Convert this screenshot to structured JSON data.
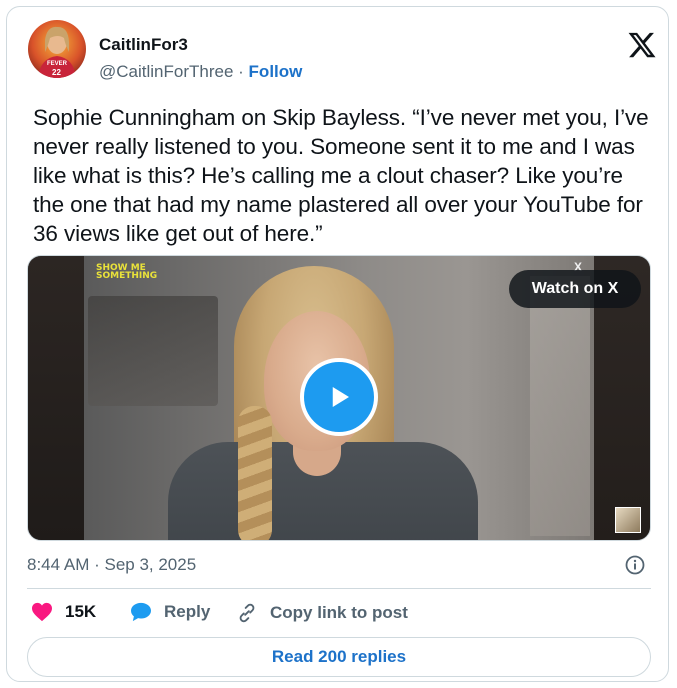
{
  "user": {
    "name": "CaitlinFor3",
    "handle": "@CaitlinForThree",
    "separator": "·",
    "follow_label": "Follow",
    "avatar_jersey_team": "FEVER",
    "avatar_jersey_number": "22"
  },
  "post": {
    "text": "Sophie Cunningham on Skip Bayless. “I’ve never met you, I’ve never really listened to you. Someone sent it to me and I was like what is this? He’s calling me a clout chaser? Like you’re the one that had my name plastered all over your YouTube for 36 views like get out of here.”",
    "timestamp": "8:44 AM · Sep 3, 2025"
  },
  "media": {
    "watch_label": "Watch on X",
    "watermark_line1": "SHOW ME",
    "watermark_line2": "SOMETHING",
    "corner_mark": "X"
  },
  "actions": {
    "likes_count": "15K",
    "reply_label": "Reply",
    "copy_label": "Copy link to post",
    "read_replies_label": "Read 200 replies"
  },
  "colors": {
    "accent": "#1d72c9",
    "play_button": "#1d9bf0",
    "like_heart": "#f91880",
    "muted_text": "#536471"
  },
  "icons": [
    "x-logo-icon",
    "play-icon",
    "info-icon",
    "heart-icon",
    "reply-bubble-icon",
    "link-icon"
  ]
}
